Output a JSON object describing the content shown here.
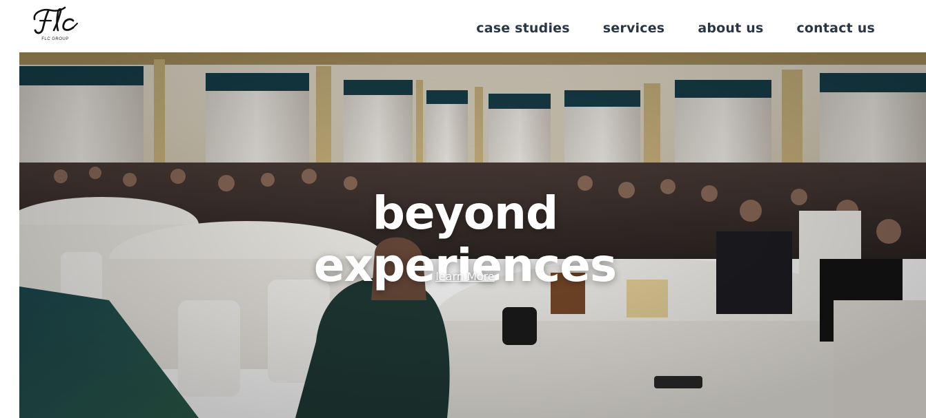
{
  "brand": {
    "logo_icon": "flc-script-logo",
    "logo_text": "Flc",
    "caption": "FLC GROUP"
  },
  "nav": {
    "items": [
      {
        "label": "case studies"
      },
      {
        "label": "services"
      },
      {
        "label": "about us"
      },
      {
        "label": "contact us"
      }
    ]
  },
  "hero": {
    "title_line1": "beyond",
    "title_line2": "experiences",
    "cta_label": "learn More",
    "background": "event-ballroom-photo"
  },
  "colors": {
    "nav_text": "#2b3645",
    "hero_text": "#ffffff",
    "header_bg": "#ffffff"
  }
}
